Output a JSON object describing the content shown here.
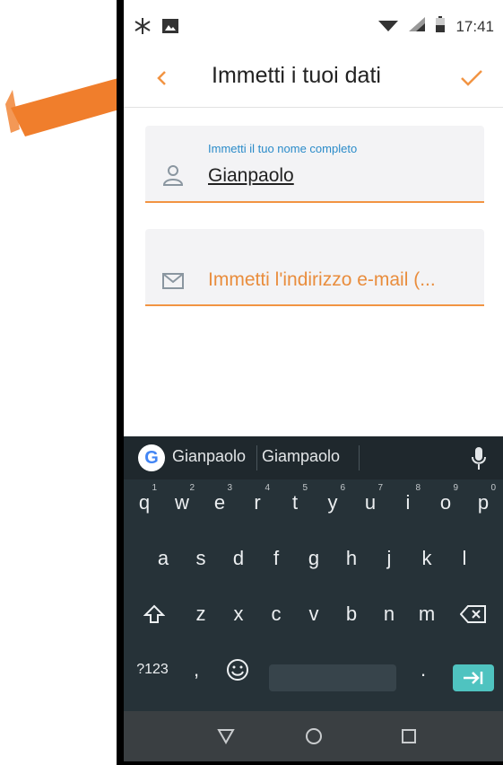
{
  "status_bar": {
    "time": "17:41",
    "icons": [
      "bluetooth-like-icon",
      "image-icon",
      "wifi-icon",
      "signal-icon",
      "battery-icon"
    ]
  },
  "app_bar": {
    "title": "Immetti i tuoi dati",
    "back_icon": "chevron-left-icon",
    "confirm_icon": "check-icon"
  },
  "form": {
    "name_field": {
      "label": "Immetti il tuo nome completo",
      "value": "Gianpaolo",
      "icon": "person-icon"
    },
    "email_field": {
      "placeholder": "Immetti l'indirizzo e-mail (...",
      "icon": "mail-icon"
    }
  },
  "keyboard": {
    "suggestions": [
      "Gianpaolo",
      "Giampaolo"
    ],
    "row1": [
      {
        "key": "q",
        "hint": "1"
      },
      {
        "key": "w",
        "hint": "2"
      },
      {
        "key": "e",
        "hint": "3"
      },
      {
        "key": "r",
        "hint": "4"
      },
      {
        "key": "t",
        "hint": "5"
      },
      {
        "key": "y",
        "hint": "6"
      },
      {
        "key": "u",
        "hint": "7"
      },
      {
        "key": "i",
        "hint": "8"
      },
      {
        "key": "o",
        "hint": "9"
      },
      {
        "key": "p",
        "hint": "0"
      }
    ],
    "row2": [
      "a",
      "s",
      "d",
      "f",
      "g",
      "h",
      "j",
      "k",
      "l"
    ],
    "row3": [
      "z",
      "x",
      "c",
      "v",
      "b",
      "n",
      "m"
    ],
    "row4": {
      "symbols": "?123",
      "comma": ",",
      "period": "."
    }
  },
  "colors": {
    "accent_orange": "#f29443",
    "label_blue": "#2a8bc9",
    "keyboard_bg": "#263238",
    "enter_key": "#4fc3c0"
  }
}
